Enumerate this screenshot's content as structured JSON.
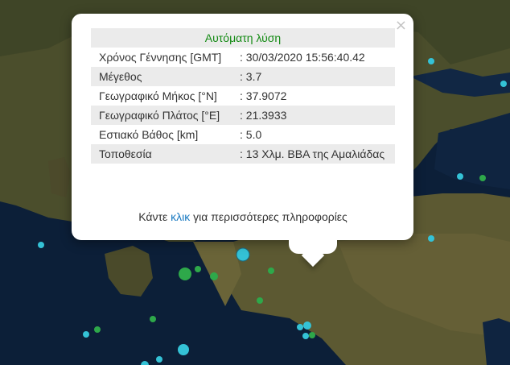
{
  "popup": {
    "header": "Αυτόματη λύση",
    "close_symbol": "×",
    "rows": [
      {
        "label": "Χρόνος Γέννησης [GMT]",
        "value": ": 30/03/2020 15:56:40.42"
      },
      {
        "label": "Μέγεθος",
        "value": ": 3.7"
      },
      {
        "label": "Γεωγραφικό Μήκος [°N]",
        "value": ": 37.9072"
      },
      {
        "label": "Γεωγραφικό Πλάτος [°E]",
        "value": ": 21.3933"
      },
      {
        "label": "Εστιακό Βάθος [km]",
        "value": ": 5.0"
      },
      {
        "label": "Τοποθεσία",
        "value": ": 13 Χλμ. ΒΒΑ της Αμαλιάδας"
      }
    ],
    "footer_prefix": "Κάντε ",
    "footer_link": "κλικ",
    "footer_suffix": " για περισσότερες πληροφορίες"
  },
  "map": {
    "colors": {
      "sea": "#0b1e36",
      "land": "#5b5a30",
      "marker_cyan": "#34c2d6",
      "marker_green": "#2ea84a"
    }
  }
}
